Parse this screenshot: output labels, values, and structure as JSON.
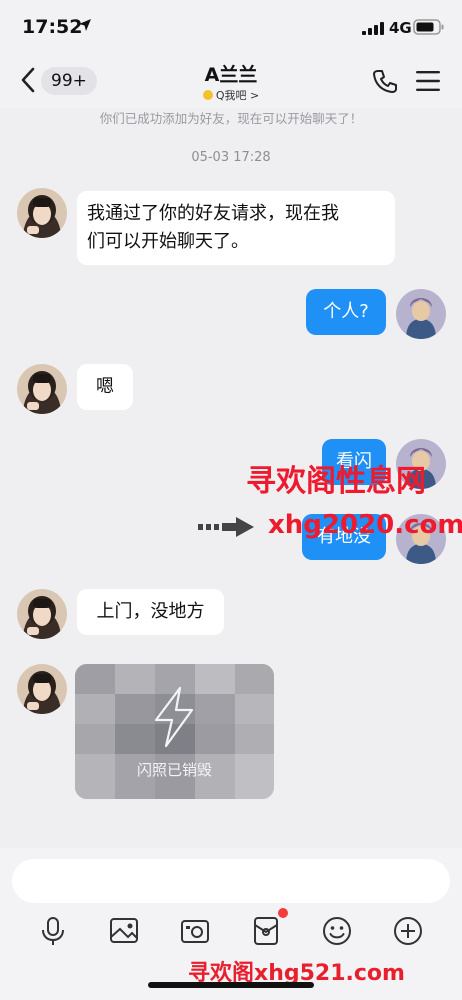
{
  "status_bar": {
    "time": "17:52",
    "network": "4G"
  },
  "header": {
    "unread_count": "99+",
    "title": "A兰兰",
    "subtitle": "Q我吧 >"
  },
  "system_note": "你们已成功添加为好友，现在可以开始聊天了！",
  "timestamp": "05-03 17:28",
  "messages": [
    {
      "side": "in",
      "text": "我通过了你的好友请求，现在我\n们可以开始聊天了。"
    },
    {
      "side": "out",
      "text": "个人?"
    },
    {
      "side": "in",
      "text": "嗯"
    },
    {
      "side": "out",
      "text": "看闪"
    },
    {
      "side": "out",
      "text": "有地没"
    },
    {
      "side": "in",
      "text": "上门，没地方"
    },
    {
      "side": "in",
      "type": "flash_photo",
      "text": "闪照已销毁"
    }
  ],
  "watermark": {
    "line1": "寻欢阁性息网",
    "url": "xhg2020.com",
    "footer": "寻欢阁xhg521.com"
  },
  "input": {
    "placeholder": ""
  },
  "toolbar": {
    "icons": [
      "microphone-icon",
      "image-icon",
      "camera-icon",
      "red-packet-icon",
      "emoji-icon",
      "plus-icon"
    ]
  },
  "colors": {
    "outgoing_bubble": "#1e90f6",
    "incoming_bubble": "#ffffff",
    "background": "#efeff2",
    "watermark": "#ee1b2e"
  }
}
